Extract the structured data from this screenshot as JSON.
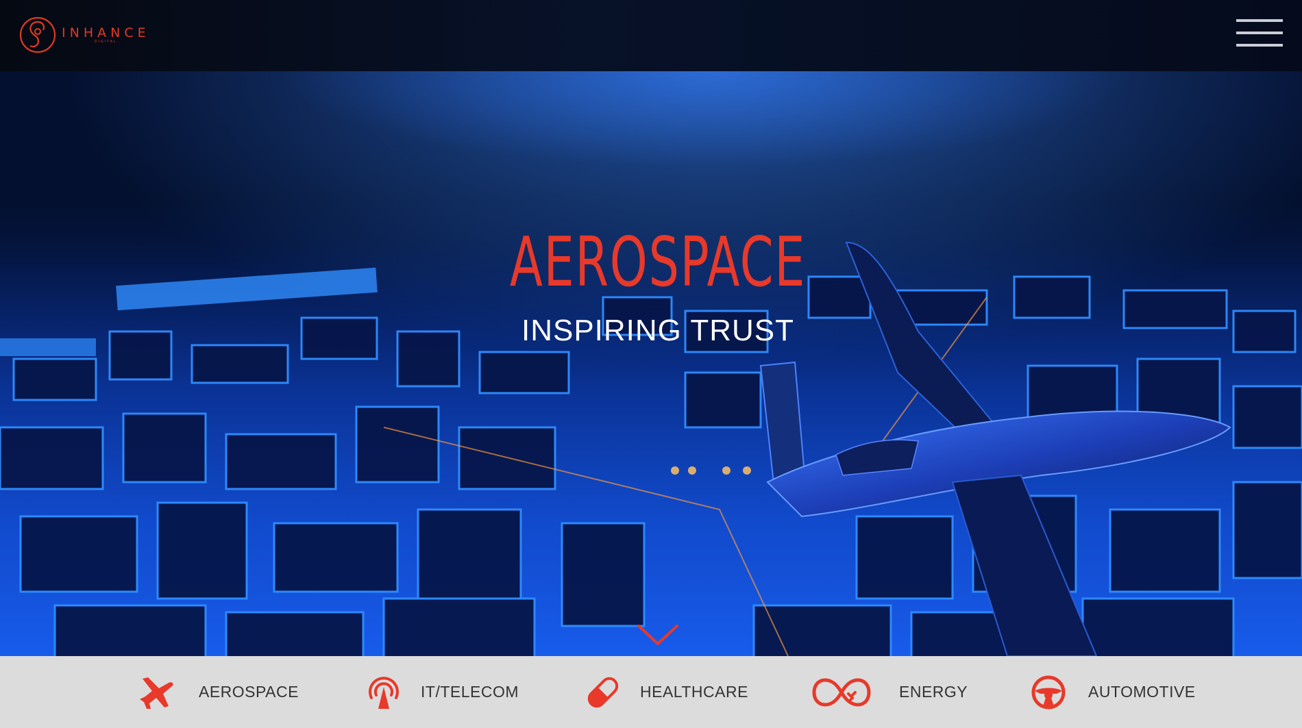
{
  "header": {
    "logo_word": "INHANCE",
    "logo_sub": "DIGITAL",
    "menu_icon": "hamburger-menu-icon"
  },
  "hero": {
    "title": "AEROSPACE",
    "subtitle": "INSPIRING TRUST",
    "scroll_icon": "chevron-down-icon"
  },
  "industries": [
    {
      "label": "AEROSPACE",
      "icon": "airplane-icon"
    },
    {
      "label": "IT/TELECOM",
      "icon": "broadcast-tower-icon"
    },
    {
      "label": "HEALTHCARE",
      "icon": "pill-capsule-icon"
    },
    {
      "label": "ENERGY",
      "icon": "infinity-plug-icon"
    },
    {
      "label": "AUTOMOTIVE",
      "icon": "steering-wheel-icon"
    }
  ],
  "colors": {
    "accent": "#e8392a",
    "header_bg": "#060c1c",
    "hero_blue": "#0a3aa8",
    "bar_bg": "#dcdcdc",
    "bar_text": "#333333"
  }
}
